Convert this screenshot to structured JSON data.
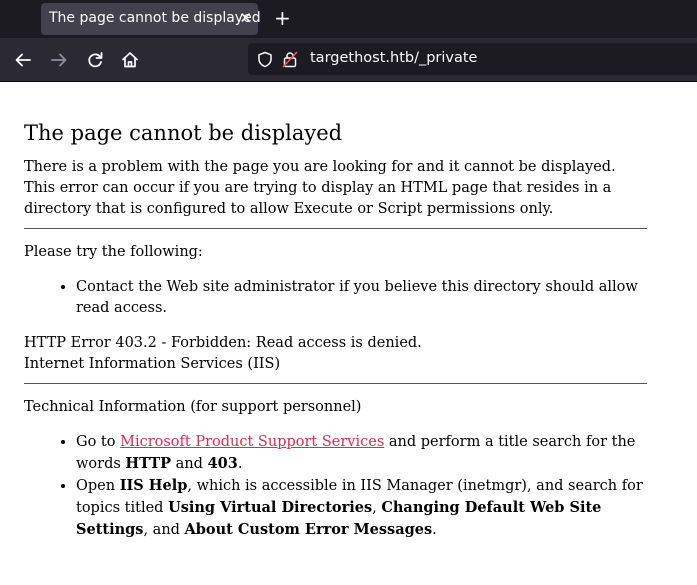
{
  "browser": {
    "tab_title": "The page cannot be displayed",
    "tab_close": "✕",
    "new_tab": "+",
    "url": "targethost.htb/_private"
  },
  "page": {
    "heading": "The page cannot be displayed",
    "intro": "There is a problem with the page you are looking for and it cannot be displayed. This error can occur if you are trying to display an HTML page that resides in a directory that is configured to allow Execute or Script permissions only.",
    "try_heading": "Please try the following:",
    "try_item": "Contact the Web site administrator if you believe this directory should allow read access.",
    "error_line": "HTTP Error 403.2 - Forbidden: Read access is denied.",
    "server_line": "Internet Information Services (IIS)",
    "tech_heading": "Technical Information (for support personnel)",
    "tech1": {
      "prefix": "Go to ",
      "link": "Microsoft Product Support Services",
      "middle": " and perform a title search for the words ",
      "b1": "HTTP",
      "and": " and ",
      "b2": "403",
      "end": "."
    },
    "tech2": {
      "prefix": "Open ",
      "b1": "IIS Help",
      "middle": ", which is accessible in IIS Manager (inetmgr), and search for topics titled ",
      "b2": "Using Virtual Directories",
      "sep1": ", ",
      "b3": "Changing Default Web Site Settings",
      "sep2": ", and ",
      "b4": "About Custom Error Messages",
      "end": "."
    }
  }
}
